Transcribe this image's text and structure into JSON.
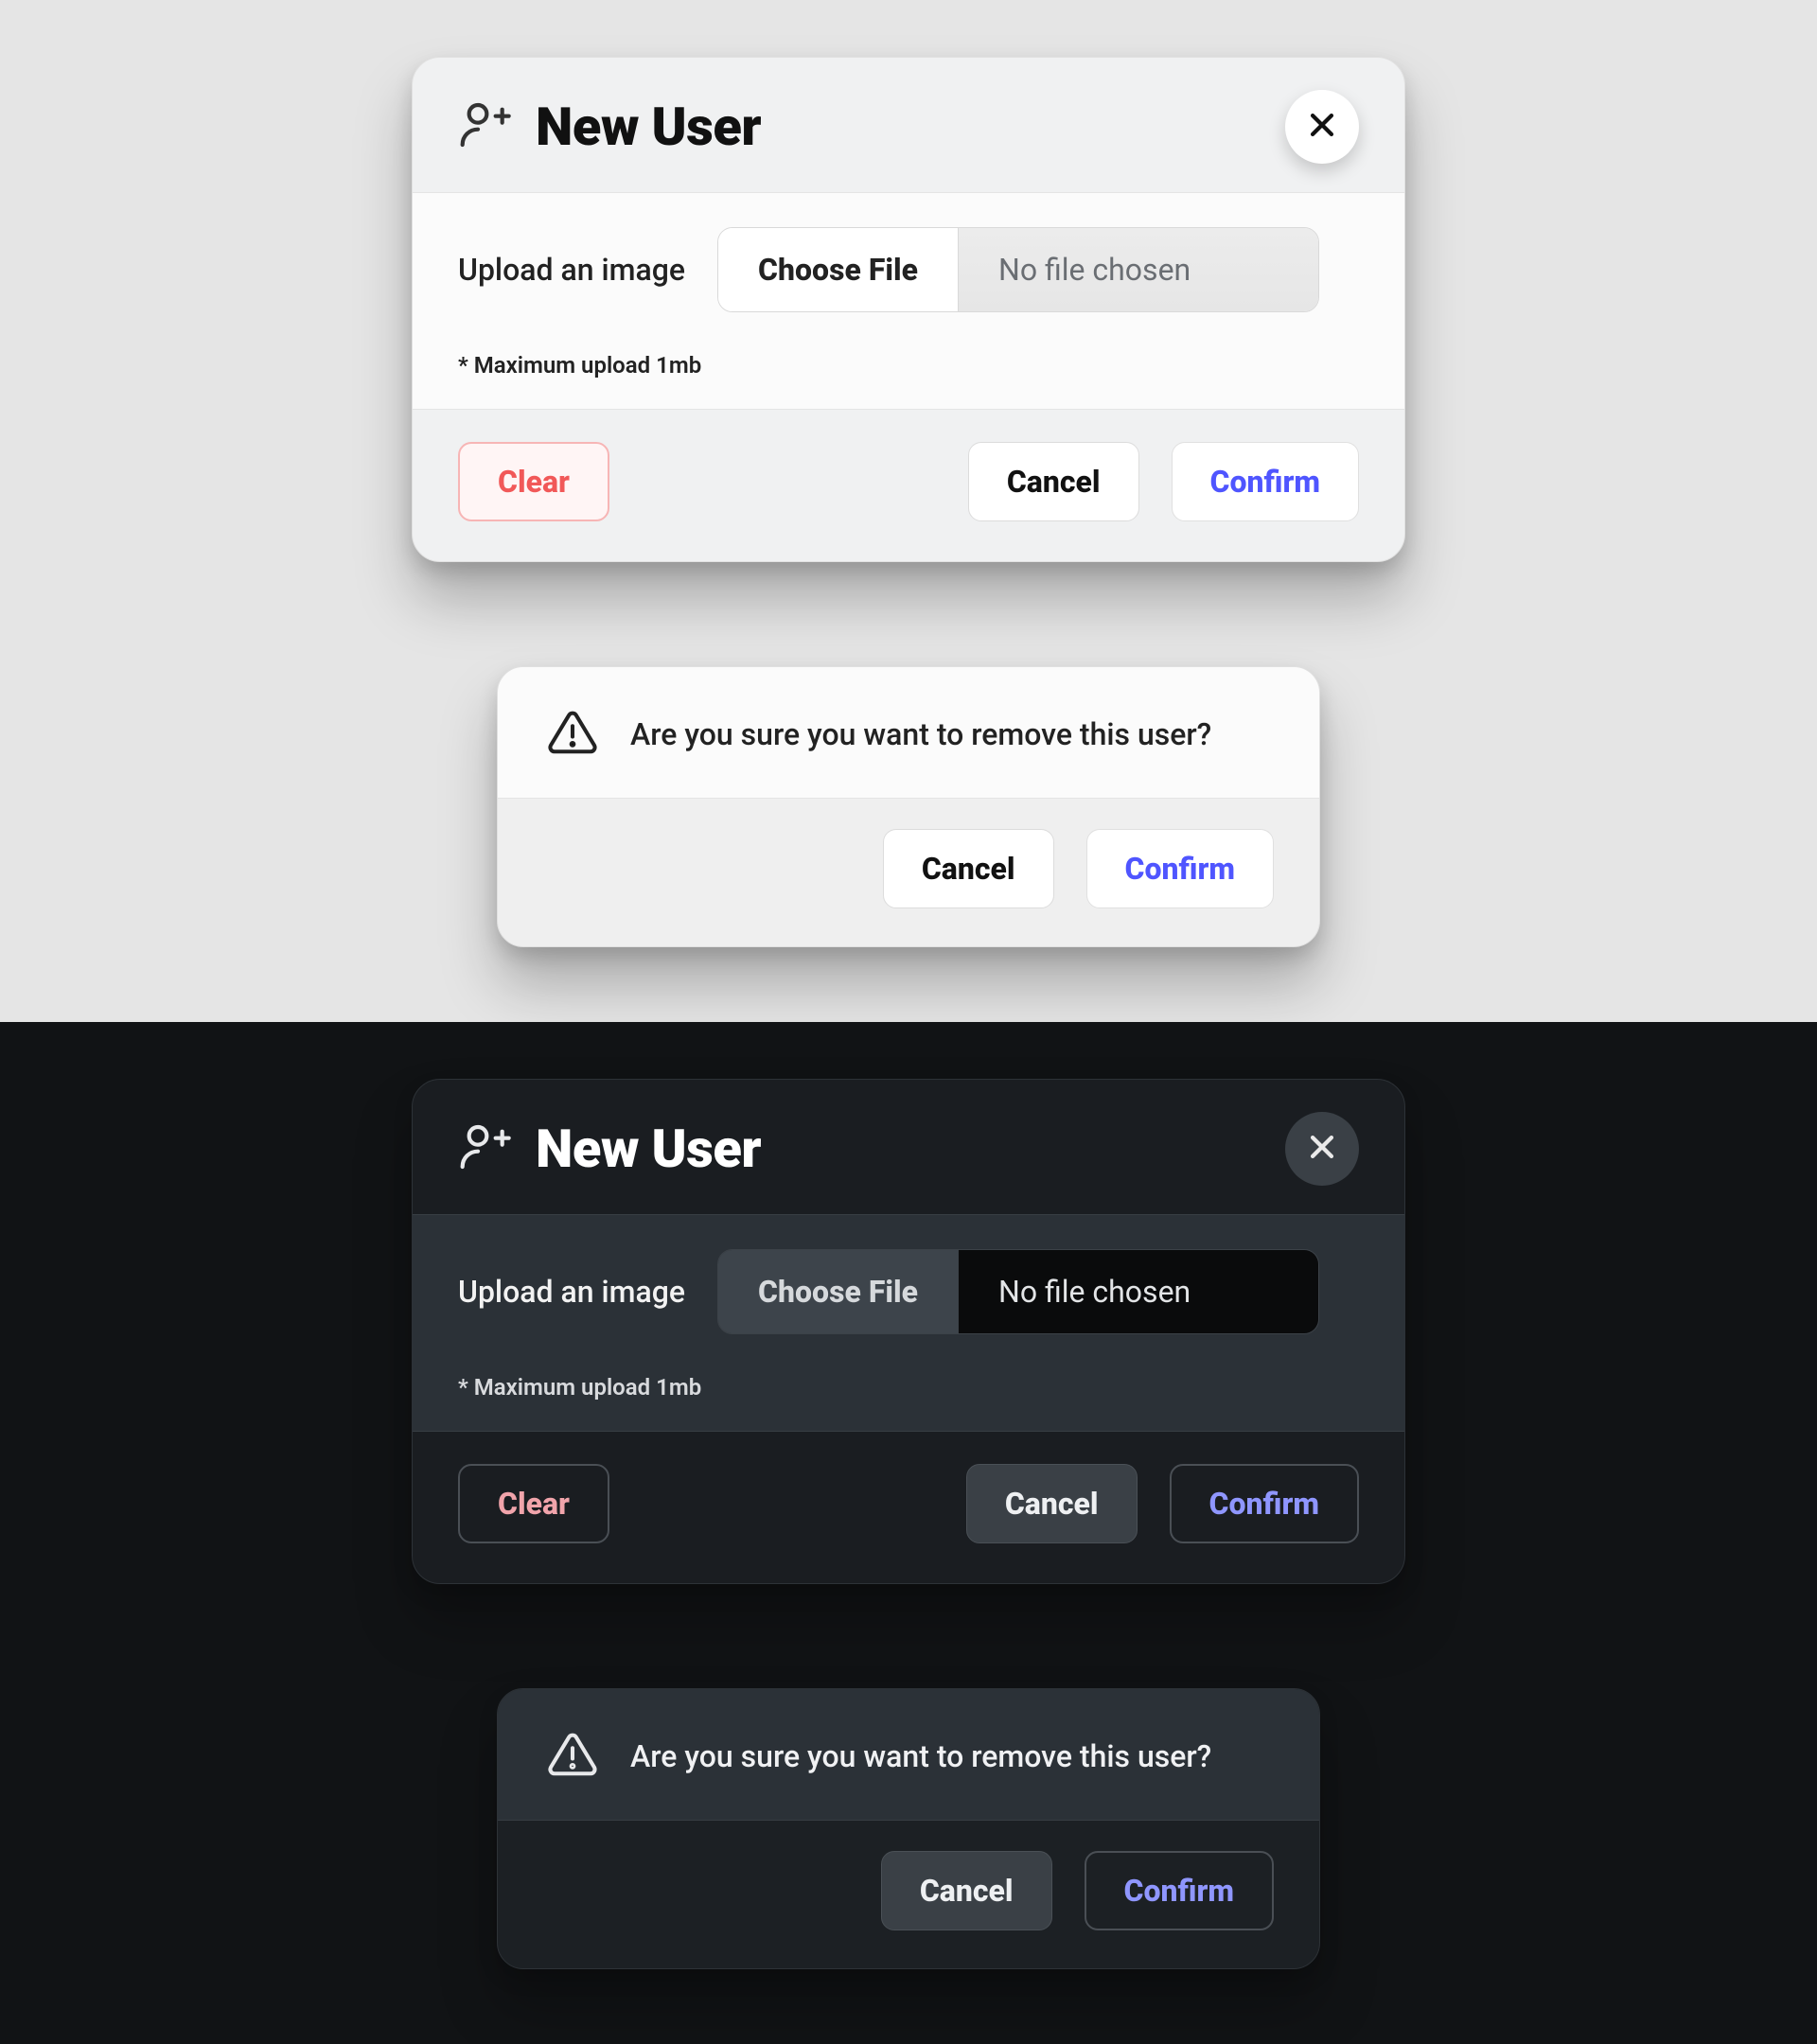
{
  "new_user_modal": {
    "title": "New User",
    "upload_label": "Upload an image",
    "choose_file_label": "Choose File",
    "file_status": "No file chosen",
    "hint": "* Maximum upload 1mb",
    "clear_label": "Clear",
    "cancel_label": "Cancel",
    "confirm_label": "Confirm"
  },
  "remove_user_dialog": {
    "message": "Are you sure you want to remove this user?",
    "cancel_label": "Cancel",
    "confirm_label": "Confirm"
  }
}
